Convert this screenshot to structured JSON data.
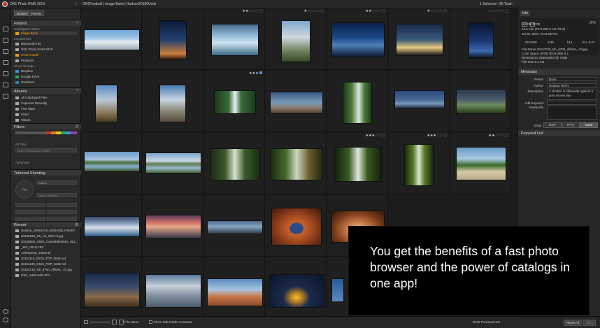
{
  "titlebar": {
    "app_title": "ON1 Photo RAW 2019",
    "breadcrumb": "ON1Football | Image Bank | Hudson20180Units",
    "selection": "1 Selected - 85 Total"
  },
  "sidebar": {
    "tabs": [
      "Browse",
      "Presets"
    ],
    "folders_header": "Folders",
    "cataloged_label": "Cataloged Folders",
    "image_bank": "Image Bank",
    "local_drives_label": "Local Drives",
    "local_items": [
      "Macintosh HD",
      "ON1 Photo RAW 2019",
      "ON1Football",
      "Products"
    ],
    "cloud_label": "Cloud Storage",
    "cloud_items": [
      "Dropbox",
      "Google Drive",
      "OneDrive"
    ],
    "albums_header": "Albums",
    "album_items": [
      "All Cataloged Files",
      "Captured Recently",
      "Five Stars",
      "Liked",
      "Videos"
    ],
    "filters_header": "Filters",
    "filter_time": "All Time",
    "filter_search": "Search Cataloged Folders",
    "filter_advanced": "Advanced",
    "tethered_header": "Tethered Shooting",
    "tethered_fire": "Fire",
    "tethered_camera": "Canon",
    "tethered_import": "Import Settings...",
    "recent_header": "Recent",
    "recent_items": [
      "Hudson_20091218_0305-Edit_RhinEF...",
      "20150228_Nh_AZ_0044-3.jpg",
      "20180605_D850_CanonBike/IMG_051...",
      "_MG_0018.CR2",
      "175imperat_sclass.tif",
      "20151116_D810_TDP_0845.nef",
      "20151130_D810_TDP_0840.nef",
      "20150730_Nh_d700_offsets_-23.jpg",
      "DSC_1366-Edit.JPG"
    ]
  },
  "grid": {
    "ratings": [
      {
        "stars": 2,
        "of": 5
      },
      {
        "stars": 1,
        "of": 5
      },
      {
        "stars": 2,
        "of": 5
      },
      {
        "stars": 1,
        "of": 5
      },
      {
        "stars": 0,
        "of": 5
      },
      {
        "stars": 3,
        "of": 5
      },
      {
        "stars": 3,
        "of": 5
      },
      {
        "stars": 3,
        "of": 5
      },
      {
        "stars": 2,
        "of": 5
      }
    ]
  },
  "rightpanel": {
    "info_tab": "Info",
    "camera": "NIKON D700",
    "lens": "13.0 mm (70.0-200.0 mm f/2.8)",
    "date": "Jul 30, 2011 • 8:11:05 PM",
    "iso": "ISO 800",
    "shutter": "1/30",
    "aperture": "f/14",
    "ev": "EV -0.67",
    "file_name": "File Name 20110730_Nh_d700_offsets_-23.jpg",
    "color_space": "Color Space sRGB IEC61966-2.1",
    "dimensions": "Dimensions 2500x1664 @ 72dpi",
    "file_size": "File Size 2.4 mb",
    "metadata_header": "Metadata",
    "preset_label": "Preset",
    "preset_value": "None",
    "author_label": "Author",
    "author_value": "Hudson Henry",
    "description_label": "Description",
    "description_value": "A climber is silhouette against a post sunset sky",
    "add_keyword_label": "Add Keyword",
    "keywords_label": "Keywords",
    "show_label": "Show",
    "show_options": [
      "EXIF",
      "IPTC",
      "None"
    ],
    "keyword_list_header": "Keyword List"
  },
  "bottombar": {
    "sort": "File Name",
    "show_sub": "Show Sub-Folder Contents",
    "raw_previews_label": "RAW Previews",
    "raw_previews_value": "Fast",
    "reset_all": "Reset All",
    "sync": "Sync"
  },
  "overlay": {
    "text": "You get the benefits of a fast photo browser and the power of catalogs in one app!"
  },
  "colors": {
    "accent": "#f39c12",
    "panel": "#2a2a2a",
    "overlay_bg": "#000000"
  }
}
